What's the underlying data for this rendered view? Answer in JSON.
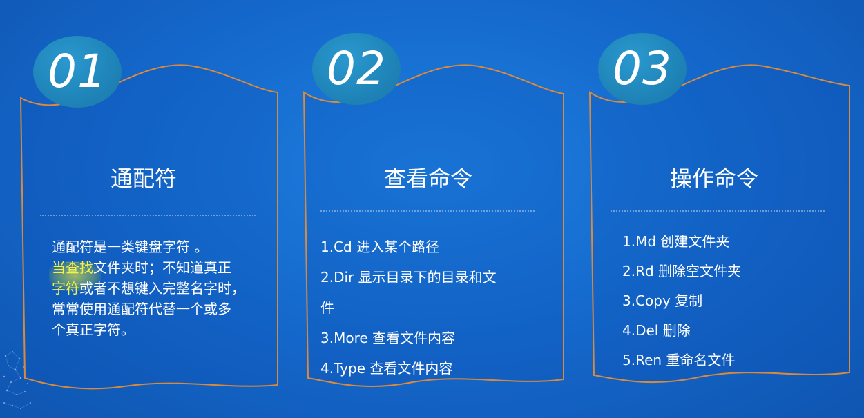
{
  "panels": [
    {
      "number": "01",
      "title": "通配符",
      "paragraph": {
        "line1": "通配符是一类键盘字符 。",
        "line2_highlight": "当查找",
        "line2_rest": "文件夹时；不知道真正",
        "line3_highlight": "字符",
        "line3_rest": "或者不想键入完整名字时，",
        "line4": "常常使用通配符代替一个或多",
        "line5": "个真正字符。"
      }
    },
    {
      "number": "02",
      "title": "查看命令",
      "items": [
        "1.Cd 进入某个路径",
        "2.Dir 显示目录下的目录和文",
        "件",
        "3.More 查看文件内容",
        "4.Type 查看文件内容"
      ]
    },
    {
      "number": "03",
      "title": "操作命令",
      "items": [
        "1.Md 创建文件夹",
        "2.Rd 删除空文件夹",
        "3.Copy 复制",
        "4.Del 删除",
        "5.Ren 重命名文件"
      ]
    }
  ],
  "colors": {
    "background": "#1466c9",
    "outline": "#d98a3c",
    "circle": "#1f84b8",
    "highlight": "#e6f03c"
  }
}
